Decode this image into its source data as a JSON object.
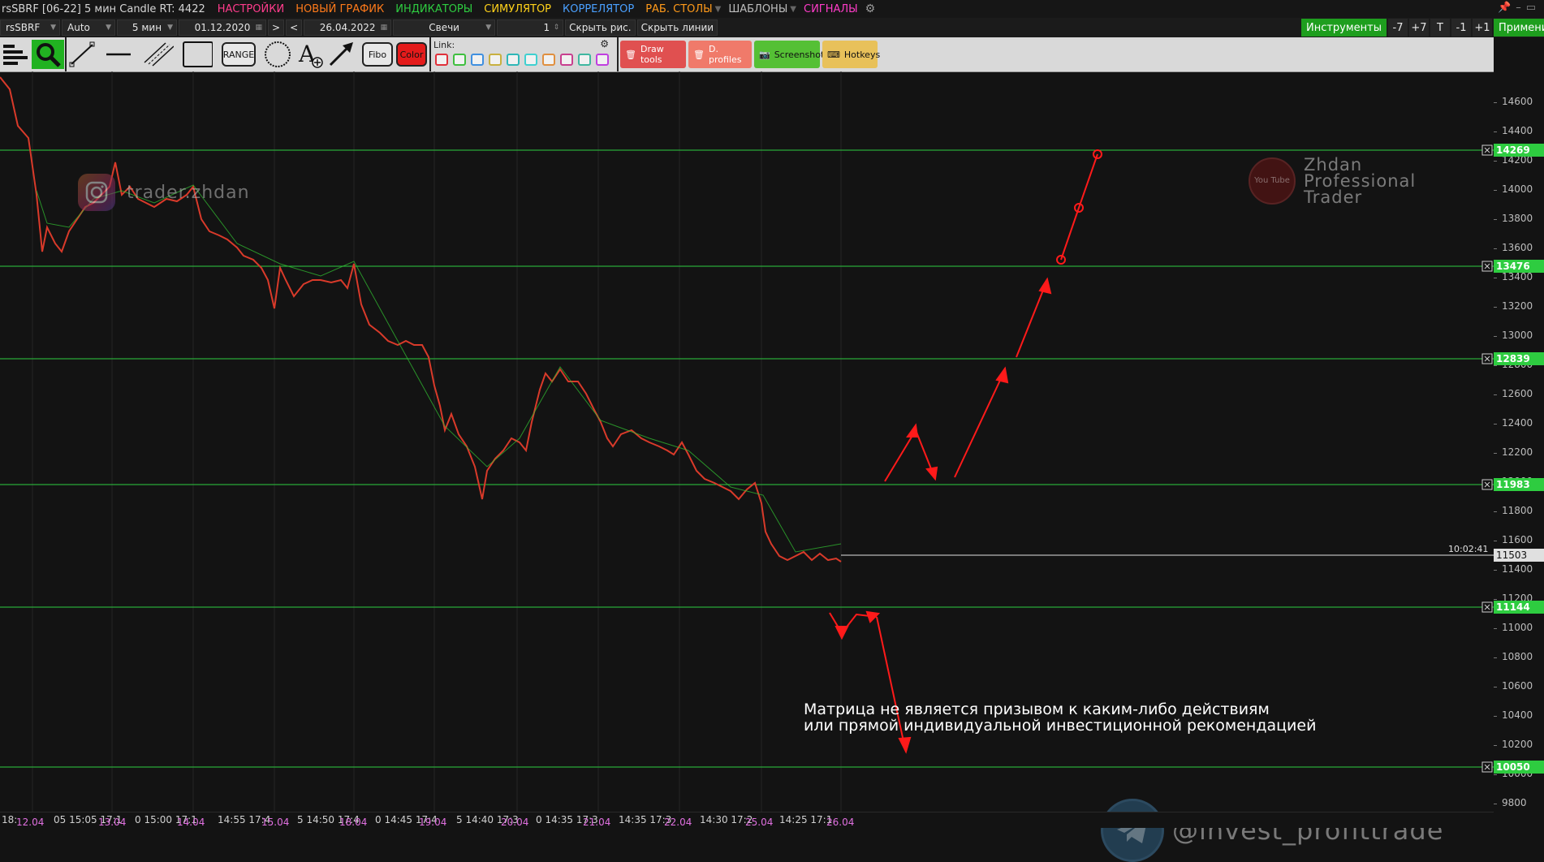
{
  "window": {
    "title": "rsSBRF [06-22] 5 мин Candle RT: 4422",
    "menu": [
      {
        "label": "НАСТРОЙКИ",
        "color": "#ff3c8c"
      },
      {
        "label": "НОВЫЙ ГРАФИК",
        "color": "#ff7a1a"
      },
      {
        "label": "ИНДИКАТОРЫ",
        "color": "#2ecc40"
      },
      {
        "label": "СИМУЛЯТОР",
        "color": "#ffd21a"
      },
      {
        "label": "КОРРЕЛЯТОР",
        "color": "#4aa0ff"
      },
      {
        "label": "РАБ. СТОЛЫ",
        "color": "#ff9a1a"
      },
      {
        "label": "ШАБЛОНЫ",
        "color": "#bdbdbd"
      },
      {
        "label": "СИГНАЛЫ",
        "color": "#ff3cc8"
      }
    ]
  },
  "params": {
    "ticker": "rsSBRF",
    "scale": "Auto",
    "timeframe": "5 мин",
    "date_from": "01.12.2020",
    "date_to": "26.04.2022",
    "chart_type": "Свечи",
    "count": "1",
    "hide_drawings": "Скрыть рис.",
    "hide_lines": "Скрыть линии",
    "nav_next": ">",
    "nav_prev": "<",
    "instruments_label": "Инструменты",
    "minus7": "-7",
    "plus7": "+7",
    "t_label": "T",
    "minus1": "-1",
    "plus1": "+1",
    "apply_label": "Применить"
  },
  "toolbar": {
    "range_label": "RANGE",
    "fibo_label": "Fibo",
    "color_label": "Color",
    "link_label": "Link:",
    "link_colors": [
      "#e0303a",
      "#3fbf3f",
      "#3f8fe0",
      "#c8b03f",
      "#2fb7b7",
      "#3fd0d0",
      "#e08f3f",
      "#c83f8f",
      "#3fb7a0",
      "#c03fe0"
    ],
    "draw_tools": {
      "label": "Draw tools",
      "color": "#e05050"
    },
    "d_profiles": {
      "label": "D. profiles",
      "color": "#f07a6a"
    },
    "screenshot": {
      "label": "Screenshot",
      "color": "#55c035"
    },
    "hotkeys": {
      "label": "Hotkeys",
      "color": "#e8c15a"
    }
  },
  "watermarks": {
    "instagram": "trader.zhdan",
    "youtube_lines": [
      "Zhdan",
      "Professional",
      "Trader"
    ],
    "youtube_badge": "You Tube",
    "telegram": "@invest_profittrade"
  },
  "disclaimer": [
    "Матрица не является призывом к каким-либо действиям",
    "или прямой индивидуальной инвестиционной рекомендацией"
  ],
  "price_axis": {
    "ticks": [
      "14600",
      "14400",
      "14200",
      "14000",
      "13800",
      "13600",
      "13400",
      "13200",
      "13000",
      "12800",
      "12600",
      "12400",
      "12200",
      "12000",
      "11800",
      "11600",
      "11400",
      "11200",
      "11000",
      "10800",
      "10600",
      "10400",
      "10200",
      "10000",
      "9800"
    ],
    "levels": [
      "14269",
      "13476",
      "12839",
      "11983",
      "11144",
      "10050"
    ],
    "current_price": "11503",
    "countdown": "10:02:41",
    "level_color": "#2ecc40"
  },
  "time_axis": {
    "labels": [
      {
        "text": "18:",
        "date": false
      },
      {
        "text": "12.04",
        "date": true
      },
      {
        "text": "05 15:05 17:1",
        "date": false
      },
      {
        "text": "13.04",
        "date": true
      },
      {
        "text": "0 15:00 17:1",
        "date": false
      },
      {
        "text": "14.04",
        "date": true
      },
      {
        "text": "14:55 17:4",
        "date": false
      },
      {
        "text": "15.04",
        "date": true
      },
      {
        "text": "5  14:50 17:4",
        "date": false
      },
      {
        "text": "18.04",
        "date": true
      },
      {
        "text": "0  14:45 17:4",
        "date": false
      },
      {
        "text": "19.04",
        "date": true
      },
      {
        "text": "5  14:40 17:3",
        "date": false
      },
      {
        "text": "20.04",
        "date": true
      },
      {
        "text": "0  14:35 17:3",
        "date": false
      },
      {
        "text": "21.04",
        "date": true
      },
      {
        "text": "14:35 17:3",
        "date": false
      },
      {
        "text": "22.04",
        "date": true
      },
      {
        "text": "14:30 17:2",
        "date": false
      },
      {
        "text": "25.04",
        "date": true
      },
      {
        "text": "14:25 17:1",
        "date": false
      },
      {
        "text": "26.04",
        "date": true
      }
    ]
  }
}
